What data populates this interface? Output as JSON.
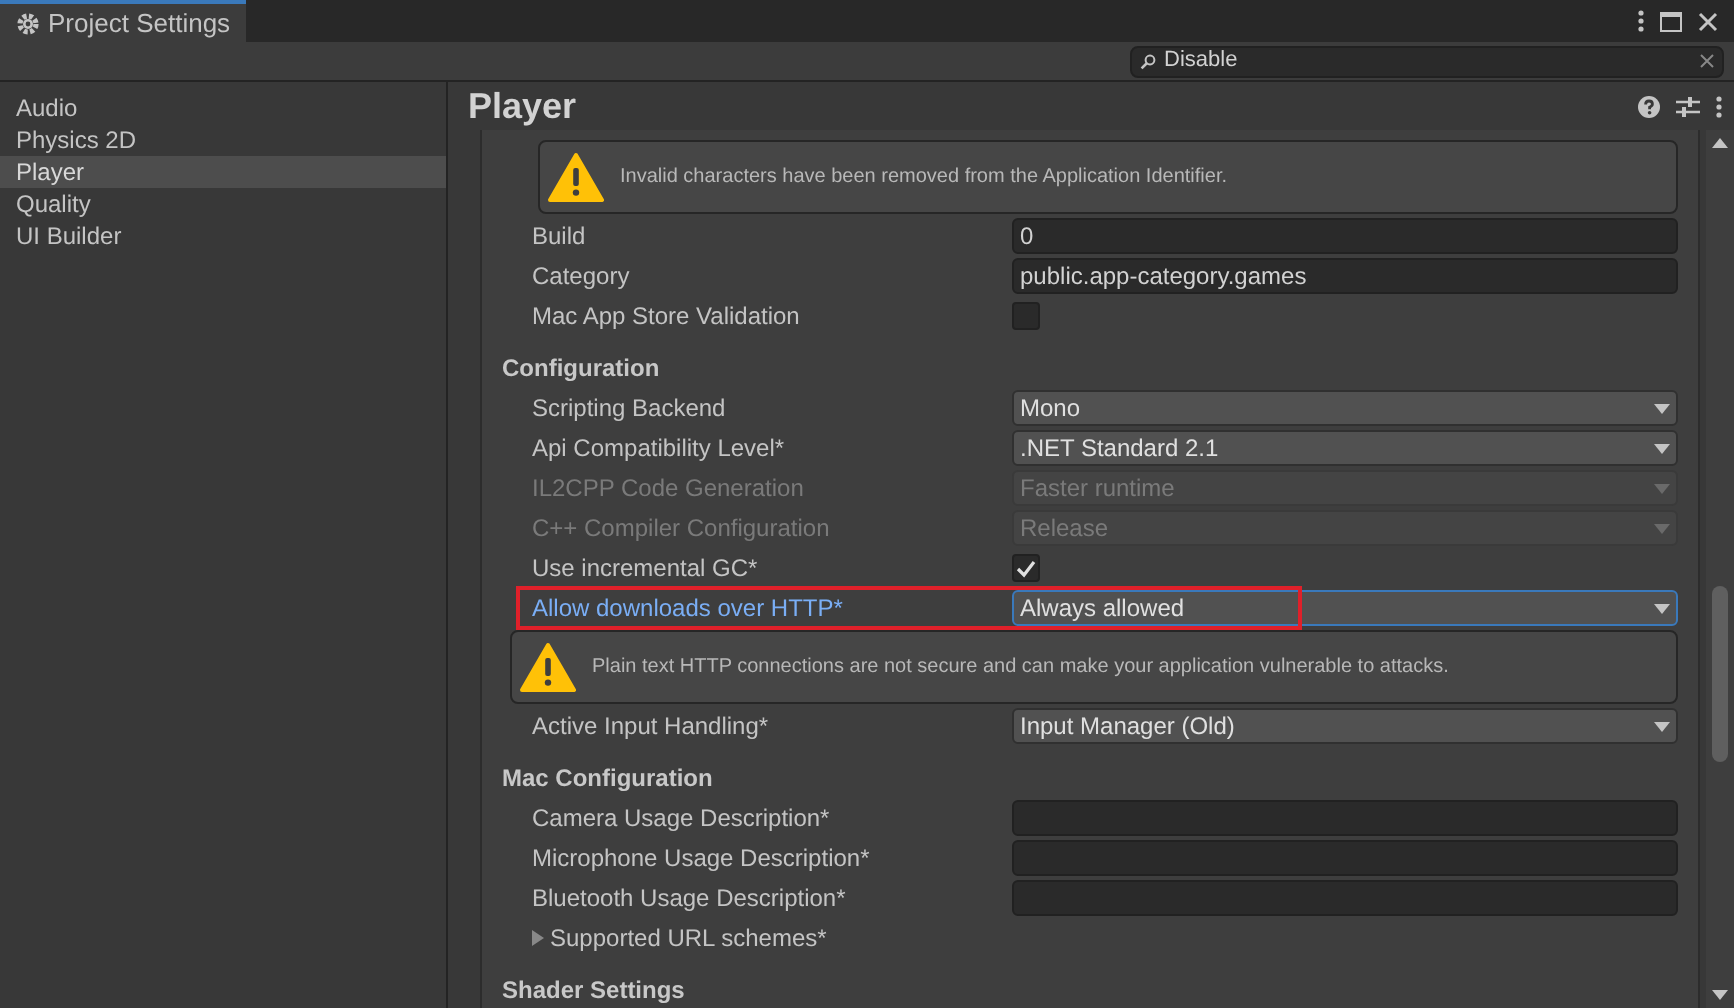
{
  "window": {
    "title": "Project Settings"
  },
  "search": {
    "value": "Disable"
  },
  "sidebar": {
    "items": [
      {
        "label": "Audio",
        "selected": false
      },
      {
        "label": "Physics 2D",
        "selected": false
      },
      {
        "label": "Player",
        "selected": true
      },
      {
        "label": "Quality",
        "selected": false
      },
      {
        "label": "UI Builder",
        "selected": false
      }
    ]
  },
  "panel": {
    "title": "Player",
    "rows": [
      {
        "kind": "warning",
        "text": "Invalid characters have been removed from the Application Identifier.",
        "indent": false
      },
      {
        "kind": "text",
        "label": "Build",
        "value": "0"
      },
      {
        "kind": "text",
        "label": "Category",
        "value": "public.app-category.games"
      },
      {
        "kind": "checkbox",
        "label": "Mac App Store Validation",
        "checked": false
      },
      {
        "kind": "header",
        "label": "Configuration"
      },
      {
        "kind": "dropdown",
        "label": "Scripting Backend",
        "value": "Mono",
        "disabled": false,
        "highlighted": false
      },
      {
        "kind": "dropdown",
        "label": "Api Compatibility Level*",
        "value": ".NET Standard 2.1",
        "disabled": false,
        "highlighted": false
      },
      {
        "kind": "dropdown",
        "label": "IL2CPP Code Generation",
        "value": "Faster runtime",
        "disabled": true,
        "highlighted": false
      },
      {
        "kind": "dropdown",
        "label": "C++ Compiler Configuration",
        "value": "Release",
        "disabled": true,
        "highlighted": false
      },
      {
        "kind": "checkbox",
        "label": "Use incremental GC*",
        "checked": true
      },
      {
        "kind": "dropdown",
        "label": "Allow downloads over HTTP*",
        "value": "Always allowed",
        "disabled": false,
        "highlighted": true
      },
      {
        "kind": "warning",
        "text": "Plain text HTTP connections are not secure and can make your application vulnerable to attacks.",
        "indent": true
      },
      {
        "kind": "dropdown",
        "label": "Active Input Handling*",
        "value": "Input Manager (Old)",
        "disabled": false,
        "highlighted": false
      },
      {
        "kind": "header",
        "label": "Mac Configuration"
      },
      {
        "kind": "text",
        "label": "Camera Usage Description*",
        "value": ""
      },
      {
        "kind": "text",
        "label": "Microphone Usage Description*",
        "value": ""
      },
      {
        "kind": "text",
        "label": "Bluetooth Usage Description*",
        "value": ""
      },
      {
        "kind": "foldout",
        "label": "Supported URL schemes*",
        "expanded": false
      },
      {
        "kind": "header",
        "label": "Shader Settings"
      }
    ]
  }
}
